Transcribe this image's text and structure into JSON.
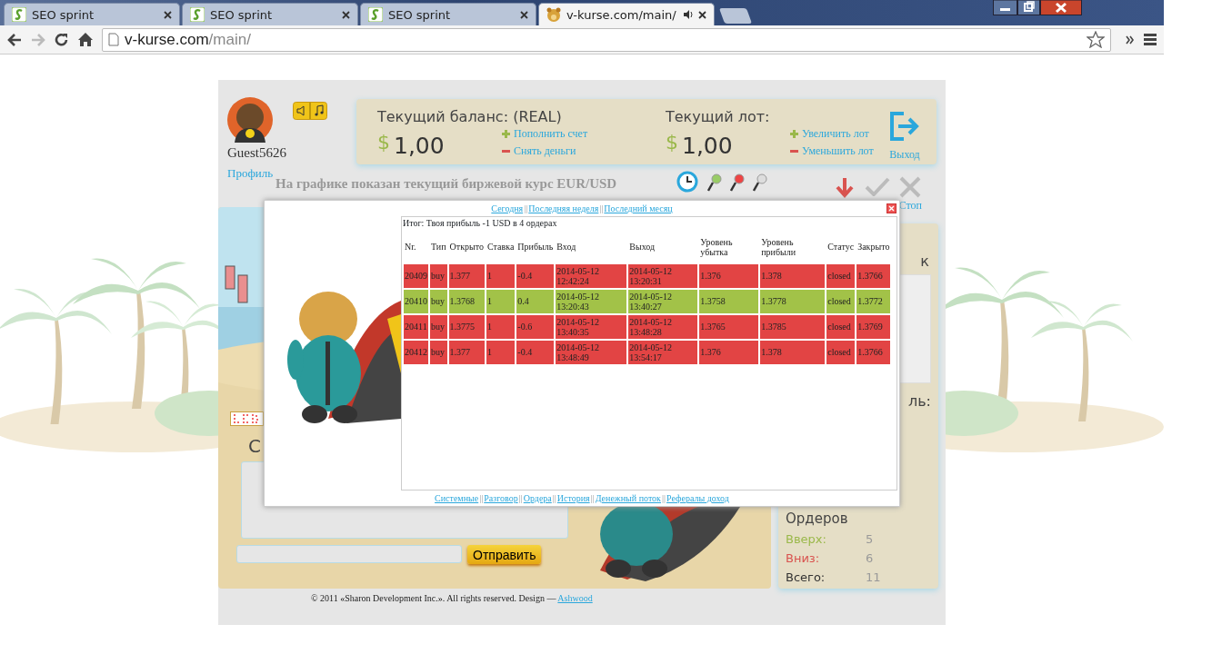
{
  "browser": {
    "tabs": [
      {
        "title": "SEO sprint",
        "kind": "seo",
        "selected": false
      },
      {
        "title": "SEO sprint",
        "kind": "seo",
        "selected": false
      },
      {
        "title": "SEO sprint",
        "kind": "seo",
        "selected": false
      },
      {
        "title": "v-kurse.com/main/",
        "kind": "site",
        "selected": true,
        "audio": true
      }
    ],
    "address": {
      "domain": "v-kurse.com",
      "path": "/main/"
    }
  },
  "user": {
    "name": "Guest5626",
    "profile_link": "Профиль"
  },
  "balance": {
    "label": "Текущий баланс: (REAL)",
    "currency": "$",
    "value": "1,00",
    "links": [
      {
        "text": "Пополнить счет",
        "kind": "plus"
      },
      {
        "text": "Снять деньги",
        "kind": "minus"
      }
    ]
  },
  "lot": {
    "label": "Текущий лот:",
    "currency": "$",
    "value": "1,00",
    "links": [
      {
        "text": "Увеличить лот",
        "kind": "plus"
      },
      {
        "text": "Уменьшить лот",
        "kind": "minus"
      }
    ]
  },
  "exit_label": "Выход",
  "chart_caption": "На графике показан текущий биржевой курс EUR/USD",
  "stop_label": "Стоп",
  "chat": {
    "title_fragment": "С",
    "send_button": "Отправить"
  },
  "right_panel": {
    "fragment_top": "к",
    "fragment_mid": "ль:",
    "orders_title": "Ордеров",
    "orders": [
      {
        "label": "Вверх:",
        "value": "5",
        "color": "#9ab84a"
      },
      {
        "label": "Вниз:",
        "value": "6",
        "color": "#d9534f"
      },
      {
        "label": "Всего:",
        "value": "11",
        "color": "#333333"
      }
    ]
  },
  "footer": {
    "text": "© 2011 «Sharon Development Inc.». All rights reserved. Design —",
    "link": "Ashwood"
  },
  "modal": {
    "separator": "||",
    "top_links": [
      "Сегодня",
      "Последняя неделя",
      "Последний месяц"
    ],
    "summary": "Итог: Твоя прибыль -1 USD в 4 ордерах",
    "columns": [
      "Nr.",
      "Тип",
      "Открыто",
      "Ставка",
      "Прибыль",
      "Вход",
      "Выход",
      "Уровень убытка",
      "Уровень прибыли",
      "Статус",
      "Закрыто"
    ],
    "rows": [
      {
        "color": "#e24444",
        "cells": [
          "20409",
          "buy",
          "1.377",
          "1",
          "-0.4",
          "2014-05-12 12:42:24",
          "2014-05-12 13:20:31",
          "1.376",
          "1.378",
          "closed",
          "1.3766"
        ]
      },
      {
        "color": "#a2c248",
        "cells": [
          "20410",
          "buy",
          "1.3768",
          "1",
          "0.4",
          "2014-05-12 13:20:43",
          "2014-05-12 13:40:27",
          "1.3758",
          "1.3778",
          "closed",
          "1.3772"
        ]
      },
      {
        "color": "#e24444",
        "cells": [
          "20411",
          "buy",
          "1.3775",
          "1",
          "-0.6",
          "2014-05-12 13:40:35",
          "2014-05-12 13:48:28",
          "1.3765",
          "1.3785",
          "closed",
          "1.3769"
        ]
      },
      {
        "color": "#e24444",
        "cells": [
          "20412",
          "buy",
          "1.377",
          "1",
          "-0.4",
          "2014-05-12 13:48:49",
          "2014-05-12 13:54:17",
          "1.376",
          "1.378",
          "closed",
          "1.3766"
        ]
      }
    ],
    "bottom_links": [
      "Системные",
      "Разговор",
      "Ордера",
      "История",
      "Денежный поток",
      "Рефералы доход"
    ]
  }
}
